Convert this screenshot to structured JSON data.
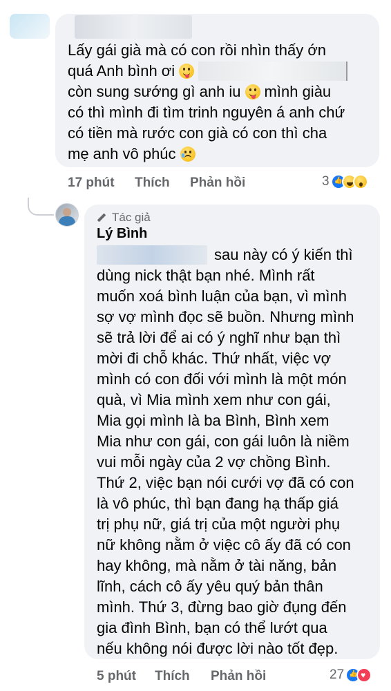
{
  "comment1": {
    "lines": [
      "Lấy gái già mà có con rồi nhìn thấy ớn",
      "quá Anh bình ơi",
      "còn sung sướng gì anh iu",
      "mình giàu",
      "có thì mình đi tìm trinh nguyên á anh chứ",
      "có tiền mà rước con già có con thì cha",
      "mẹ anh vô phúc"
    ],
    "time": "17 phút",
    "like_label": "Thích",
    "reply_label": "Phản hồi",
    "reaction_count": "3",
    "reaction_icons": [
      "like-icon",
      "haha-icon",
      "wow-icon"
    ]
  },
  "reply": {
    "badge": "Tác giả",
    "author": "Lý Bình",
    "first_line_tail": "sau này có ý kiến thì",
    "lines": [
      "dùng nick thật bạn nhé. Mình rất",
      "muốn xoá bình luận của bạn, vì mình",
      "sợ vợ mình đọc sẽ buồn. Nhưng mình",
      "sẽ trả lời để ai có ý nghĩ như bạn thì",
      "mời đi chỗ khác. Thứ nhất, việc vợ",
      "mình có con đối với mình là một món",
      "quà, vì Mia mình xem như con gái,",
      "Mia gọi mình là ba Bình, Bình xem",
      "Mia như con gái, con gái luôn là niềm",
      "vui mỗi ngày của 2 vợ chồng Bình.",
      "Thứ 2, việc bạn nói cưới vợ đã có con",
      "là vô phúc, thì bạn đang hạ thấp giá",
      "trị phụ nữ, giá trị của một người phụ",
      "nữ không nằm ở việc cô ấy đã có con",
      "hay không, mà nằm ở tài năng, bản",
      "lĩnh, cách cô ấy yêu quý bản thân",
      "mình. Thứ 3, đừng bao giờ đụng đến",
      "gia đình Bình, bạn có thể lướt qua",
      "nếu không nói được lời nào tốt đẹp."
    ],
    "time": "5 phút",
    "like_label": "Thích",
    "reply_label": "Phản hồi",
    "reaction_count": "27",
    "reaction_icons": [
      "like-icon",
      "love-icon"
    ]
  }
}
